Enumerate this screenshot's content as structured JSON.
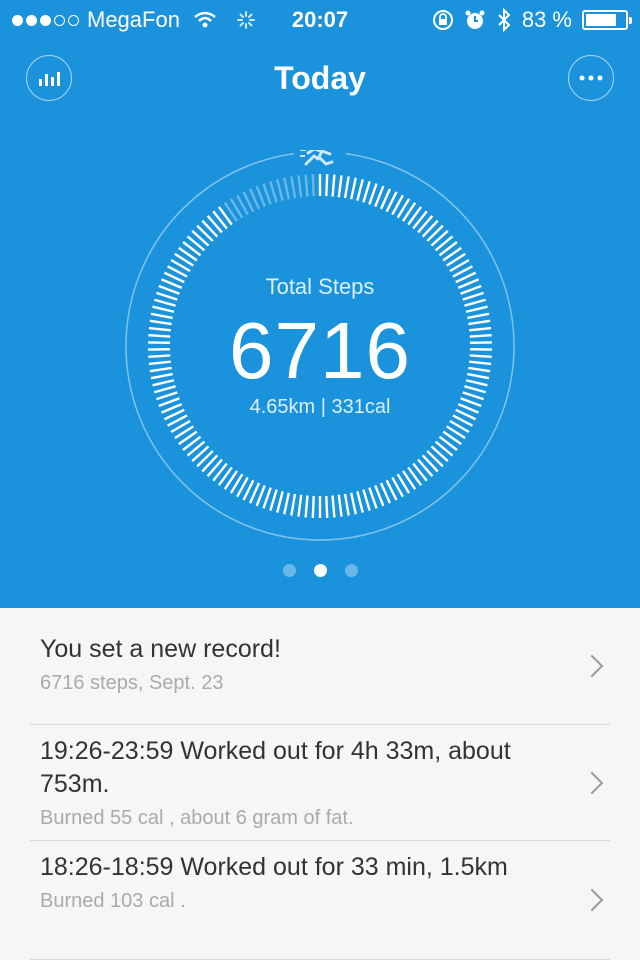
{
  "status_bar": {
    "carrier": "MegaFon",
    "time": "20:07",
    "battery": "83 %",
    "battery_level": 0.83,
    "signal_bars_filled": 3,
    "signal_bars_total": 5
  },
  "header": {
    "title": "Today"
  },
  "ring": {
    "label": "Total Steps",
    "value": "6716",
    "summary": "4.65km | 331cal",
    "progress_fraction": 0.9
  },
  "pager": {
    "pages": 3,
    "active": 1
  },
  "feed": [
    {
      "title": "You set a new record!",
      "detail": "6716 steps, Sept. 23"
    },
    {
      "title": "19:26-23:59  Worked out for 4h 33m, about 753m.",
      "detail": "Burned 55 cal , about 6 gram of fat."
    },
    {
      "title": "18:26-18:59  Worked out for 33 min, 1.5km",
      "detail": "Burned 103 cal ."
    }
  ],
  "colors": {
    "primary": "#1a93dc",
    "background": "#f6f6f6"
  }
}
